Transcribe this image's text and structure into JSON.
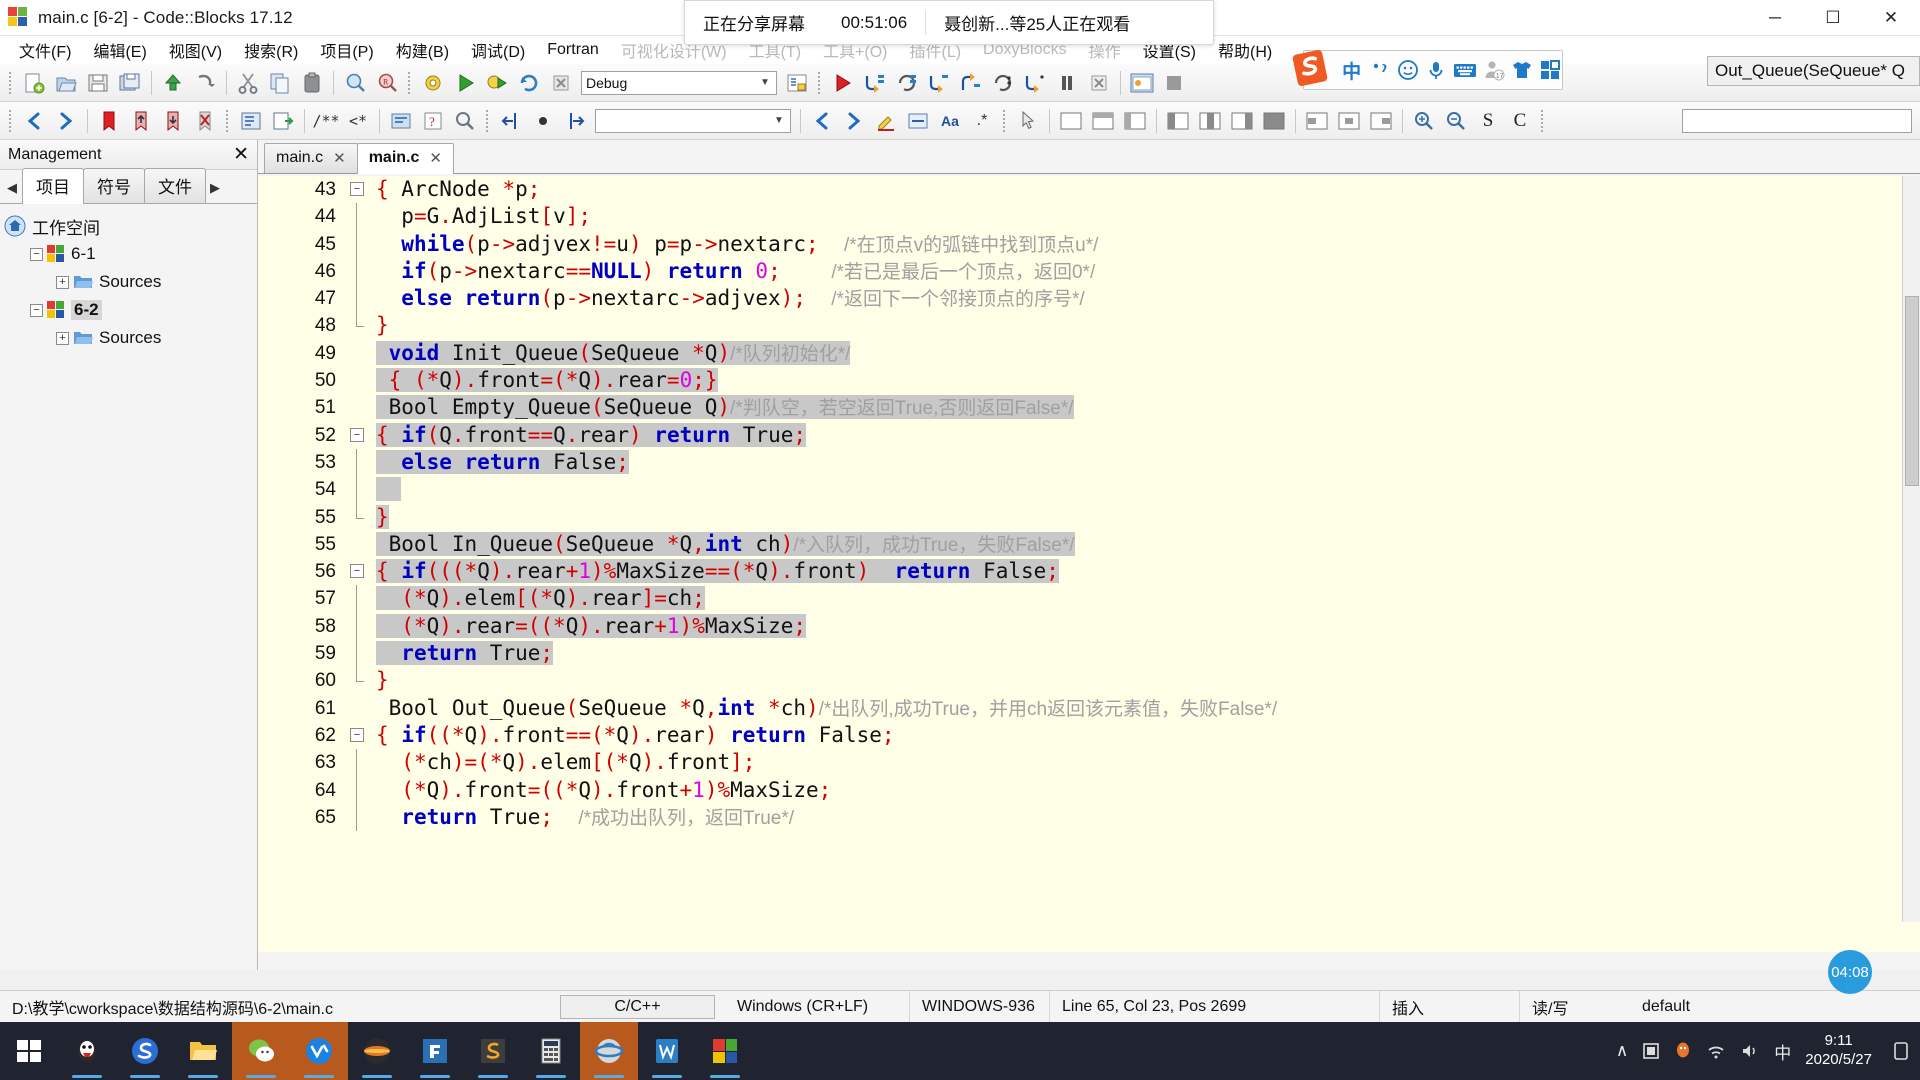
{
  "window": {
    "title": "main.c [6-2] - Code::Blocks 17.12",
    "minimize": "─",
    "maximize": "☐",
    "close": "✕"
  },
  "conference_overlay": {
    "sharing_label": "正在分享屏幕",
    "elapsed": "00:51:06",
    "viewers": "聂创新...等25人正在观看"
  },
  "menubar": {
    "items": [
      {
        "label": "文件(F)",
        "faded": false
      },
      {
        "label": "编辑(E)",
        "faded": false
      },
      {
        "label": "视图(V)",
        "faded": false
      },
      {
        "label": "搜索(R)",
        "faded": false
      },
      {
        "label": "项目(P)",
        "faded": false
      },
      {
        "label": "构建(B)",
        "faded": false
      },
      {
        "label": "调试(D)",
        "faded": false
      },
      {
        "label": "Fortran",
        "faded": false
      },
      {
        "label": "可视化设计(W)",
        "faded": true
      },
      {
        "label": "工具(T)",
        "faded": true
      },
      {
        "label": "工具+(O)",
        "faded": true
      },
      {
        "label": "插件(L)",
        "faded": true
      },
      {
        "label": "DoxyBlocks",
        "faded": true
      },
      {
        "label": "操作",
        "faded": true
      },
      {
        "label": "设置(S)",
        "faded": false
      },
      {
        "label": "帮助(H)",
        "faded": false
      }
    ]
  },
  "toolbar_main": {
    "build_target_value": "Debug",
    "build_target_arrow": "▼",
    "icons": [
      "new-file-icon",
      "open-file-icon",
      "save-icon",
      "save-all-icon",
      "undo-icon",
      "redo-icon",
      "cut-icon",
      "copy-icon",
      "paste-icon",
      "find-icon",
      "replace-icon",
      "build-icon",
      "run-icon",
      "build-and-run-icon",
      "rebuild-icon",
      "abort-icon",
      "build-target-select",
      "build-log-icon",
      "debug-continue-icon",
      "debug-next-line-icon",
      "debug-step-into-icon",
      "debug-step-out-icon",
      "debug-next-instruction-icon",
      "debug-step-into-instruction-icon",
      "debug-break-icon",
      "debug-stop-icon",
      "debugging-windows-icon",
      "various-info-icon"
    ]
  },
  "toolbar_secondary": {
    "scope_value": "",
    "scope_arrow": "▼",
    "search_value": "",
    "icons": [
      "back-icon",
      "forward-icon",
      "toggle-bookmark-icon",
      "prev-bookmark-icon",
      "next-bookmark-icon",
      "clear-bookmarks-icon",
      "fortran-workspace-icon",
      "fortran-jump-icon",
      "comment-icon",
      "uncomment-icon",
      "doxyblocks-extract-icon",
      "doxyblocks-config-icon",
      "scope-combo",
      "prev-function-icon",
      "next-function-icon",
      "highlight-icon",
      "format-icon",
      "case-icon",
      "wildcard-icon",
      "select-tool-icon",
      "frame-icon",
      "panel-icon",
      "note-icon",
      "layout-1-icon",
      "layout-2-icon",
      "layout-3-icon",
      "layout-4-icon",
      "box-1-icon",
      "box-2-icon",
      "box-3-icon",
      "box-4-icon",
      "zoom-in-icon",
      "zoom-out-icon",
      "spell-s-icon",
      "spell-c-icon"
    ]
  },
  "param_hint": "Out_Queue(SeQueue* Q",
  "sogou_toolbar": {
    "logo": "sogou-logo-icon",
    "items": [
      "chinese-mode-icon",
      "punctuation-icon",
      "emoji-icon",
      "voice-input-icon",
      "soft-keyboard-icon",
      "user-icon",
      "skin-icon",
      "toolbox-icon"
    ],
    "chinese_label": "中"
  },
  "management": {
    "title": "Management",
    "close_label": "✕",
    "prev_arrow": "◀",
    "next_arrow": "▶",
    "tabs": [
      {
        "label": "项目",
        "active": true
      },
      {
        "label": "符号",
        "active": false
      },
      {
        "label": "文件",
        "active": false
      }
    ],
    "tree": [
      {
        "label": "工作空间",
        "level": 0,
        "icon": "workspace-home-icon",
        "expander": null,
        "selected": false
      },
      {
        "label": "6-1",
        "level": 1,
        "icon": "project-icon",
        "expander": "−",
        "selected": false
      },
      {
        "label": "Sources",
        "level": 2,
        "icon": "folder-icon",
        "expander": "+",
        "selected": false
      },
      {
        "label": "6-2",
        "level": 1,
        "icon": "project-icon",
        "expander": "−",
        "selected": true
      },
      {
        "label": "Sources",
        "level": 2,
        "icon": "folder-icon",
        "expander": "+",
        "selected": false
      }
    ]
  },
  "editor": {
    "tabs": [
      {
        "label": "main.c",
        "active": false,
        "close": "✕"
      },
      {
        "label": "main.c",
        "active": true,
        "close": "✕"
      }
    ],
    "first_line": 43,
    "lines": [
      {
        "num": 43,
        "fold": "minus",
        "html": "<span class=\"p\">{</span> ArcNode <span class=\"p\">*</span>p<span class=\"p\">;</span>"
      },
      {
        "num": 44,
        "fold": "bar",
        "html": "  p<span class=\"p\">=</span>G<span class=\"p\">.</span>AdjList<span class=\"p\">[</span>v<span class=\"p\">];</span>"
      },
      {
        "num": 45,
        "fold": "bar",
        "html": "  <span class=\"k\">while</span><span class=\"p\">(</span>p<span class=\"p\">-&gt;</span>adjvex<span class=\"p\">!=</span>u<span class=\"p\">)</span> p<span class=\"p\">=</span>p<span class=\"p\">-&gt;</span>nextarc<span class=\"p\">;</span>  <span class=\"c\">/*在顶点v的弧链中找到顶点u*/</span>"
      },
      {
        "num": 46,
        "fold": "bar",
        "html": "  <span class=\"k\">if</span><span class=\"p\">(</span>p<span class=\"p\">-&gt;</span>nextarc<span class=\"p\">==</span><span class=\"k\">NULL</span><span class=\"p\">)</span> <span class=\"k\">return</span> <span class=\"n\">0</span><span class=\"p\">;</span>    <span class=\"c\">/*若已是最后一个顶点，返回0*/</span>"
      },
      {
        "num": 47,
        "fold": "bar",
        "html": "  <span class=\"k\">else</span> <span class=\"k\">return</span><span class=\"p\">(</span>p<span class=\"p\">-&gt;</span>nextarc<span class=\"p\">-&gt;</span>adjvex<span class=\"p\">);</span>  <span class=\"c\">/*返回下一个邻接顶点的序号*/</span>"
      },
      {
        "num": 48,
        "fold": "end",
        "html": "<span class=\"p\">}</span>"
      },
      {
        "num": 49,
        "fold": null,
        "html": "<span class=\"hl\"> <span class=\"k\">void</span> Init_Queue<span class=\"p\">(</span>SeQueue <span class=\"p\">*</span>Q<span class=\"p\">)</span><span class=\"c\">/*队列初始化*/</span></span>"
      },
      {
        "num": 50,
        "fold": null,
        "html": "<span class=\"hl\"> <span class=\"p\">{</span> <span class=\"p\">(*</span>Q<span class=\"p\">).</span>front<span class=\"p\">=(*</span>Q<span class=\"p\">).</span>rear<span class=\"p\">=</span><span class=\"n\">0</span><span class=\"p\">;}</span></span>"
      },
      {
        "num": 51,
        "fold": null,
        "html": "<span class=\"hl\"> Bool Empty_Queue<span class=\"p\">(</span>SeQueue Q<span class=\"p\">)</span><span class=\"c\">/*判队空，若空返回True,否则返回False*/</span></span>"
      },
      {
        "num": 52,
        "fold": "minus",
        "html": "<span class=\"hl\"><span class=\"p\">{</span> <span class=\"k\">if</span><span class=\"p\">(</span>Q<span class=\"p\">.</span>front<span class=\"p\">==</span>Q<span class=\"p\">.</span>rear<span class=\"p\">)</span> <span class=\"k\">return</span> True<span class=\"p\">;</span></span>"
      },
      {
        "num": 53,
        "fold": "bar",
        "html": "<span class=\"hl\">  <span class=\"k\">else</span> <span class=\"k\">return</span> False<span class=\"p\">;</span></span>"
      },
      {
        "num": 54,
        "fold": "bar",
        "html": "<span class=\"hl\">  </span>"
      },
      {
        "num": 55,
        "fold": "end",
        "html": "<span class=\"hl\"><span class=\"p\">}</span></span>"
      },
      {
        "num": 55,
        "fold": null,
        "html": "<span class=\"hl\"> Bool In_Queue<span class=\"p\">(</span>SeQueue <span class=\"p\">*</span>Q<span class=\"p\">,</span><span class=\"k\">int</span> ch<span class=\"p\">)</span><span class=\"c\">/*入队列，成功True，失败False*/</span></span>"
      },
      {
        "num": 56,
        "fold": "minus",
        "html": "<span class=\"hl\"><span class=\"p\">{</span> <span class=\"k\">if</span><span class=\"p\">(((*</span>Q<span class=\"p\">).</span>rear<span class=\"p\">+</span><span class=\"n\">1</span><span class=\"p\">)%</span>MaxSize<span class=\"p\">==(*</span>Q<span class=\"p\">).</span>front<span class=\"p\">)</span>  <span class=\"k\">return</span> False<span class=\"p\">;</span></span>"
      },
      {
        "num": 57,
        "fold": "bar",
        "html": "<span class=\"hl\">  <span class=\"p\">(*</span>Q<span class=\"p\">).</span>elem<span class=\"p\">[(*</span>Q<span class=\"p\">).</span>rear<span class=\"p\">]=</span>ch<span class=\"p\">;</span></span>"
      },
      {
        "num": 58,
        "fold": "bar",
        "html": "<span class=\"hl\">  <span class=\"p\">(*</span>Q<span class=\"p\">).</span>rear<span class=\"p\">=((*</span>Q<span class=\"p\">).</span>rear<span class=\"p\">+</span><span class=\"n\">1</span><span class=\"p\">)%</span>MaxSize<span class=\"p\">;</span></span>"
      },
      {
        "num": 59,
        "fold": "bar",
        "html": "<span class=\"hl\">  <span class=\"k\">return</span> True<span class=\"p\">;</span></span>"
      },
      {
        "num": 60,
        "fold": "end",
        "html": "<span class=\"p\">}</span>"
      },
      {
        "num": 61,
        "fold": null,
        "html": " Bool Out_Queue<span class=\"p\">(</span>SeQueue <span class=\"p\">*</span>Q<span class=\"p\">,</span><span class=\"k\">int</span> <span class=\"p\">*</span>ch<span class=\"p\">)</span><span class=\"c\">/*出队列,成功True，并用ch返回该元素值，失败False*/</span>"
      },
      {
        "num": 62,
        "fold": "minus",
        "html": "<span class=\"p\">{</span> <span class=\"k\">if</span><span class=\"p\">((*</span>Q<span class=\"p\">).</span>front<span class=\"p\">==(*</span>Q<span class=\"p\">).</span>rear<span class=\"p\">)</span> <span class=\"k\">return</span> False<span class=\"p\">;</span>"
      },
      {
        "num": 63,
        "fold": "bar",
        "html": "  <span class=\"p\">(*</span>ch<span class=\"p\">)=(*</span>Q<span class=\"p\">).</span>elem<span class=\"p\">[(*</span>Q<span class=\"p\">).</span>front<span class=\"p\">];</span>"
      },
      {
        "num": 64,
        "fold": "bar",
        "html": "  <span class=\"p\">(*</span>Q<span class=\"p\">).</span>front<span class=\"p\">=((*</span>Q<span class=\"p\">).</span>front<span class=\"p\">+</span><span class=\"n\">1</span><span class=\"p\">)%</span>MaxSize<span class=\"p\">;</span>"
      },
      {
        "num": 65,
        "fold": "bar",
        "html": "  <span class=\"k\">return</span> True<span class=\"p\">;</span>  <span class=\"c\">/*成功出队列，返回True*/</span>"
      }
    ]
  },
  "timer_badge": "04:08",
  "statusbar": {
    "path": "D:\\教学\\cworkspace\\数据结构源码\\6-2\\main.c",
    "language": "C/C++",
    "line_ending": "Windows (CR+LF)",
    "encoding": "WINDOWS-936",
    "caret": "Line 65, Col 23, Pos 2699",
    "insert_mode": "插入",
    "read_write": "读/写",
    "profile": "default"
  },
  "taskbar": {
    "start": "start-button",
    "items": [
      {
        "name": "taskbar-qq",
        "running": true,
        "active": false
      },
      {
        "name": "taskbar-sogou-browser",
        "running": true,
        "active": false
      },
      {
        "name": "taskbar-file-explorer",
        "running": true,
        "active": false
      },
      {
        "name": "taskbar-wechat",
        "running": true,
        "active": true
      },
      {
        "name": "taskbar-tencent-meeting",
        "running": true,
        "active": true
      },
      {
        "name": "taskbar-firefox",
        "running": true,
        "active": false
      },
      {
        "name": "taskbar-editor",
        "running": true,
        "active": false
      },
      {
        "name": "taskbar-sublime",
        "running": true,
        "active": false
      },
      {
        "name": "taskbar-calculator",
        "running": true,
        "active": false
      },
      {
        "name": "taskbar-ie",
        "running": true,
        "active": true
      },
      {
        "name": "taskbar-wps",
        "running": true,
        "active": false
      },
      {
        "name": "taskbar-codeblocks",
        "running": true,
        "active": false
      }
    ],
    "tray": {
      "chevron": "∧",
      "icons": [
        "tray-show-desktop-icon",
        "tray-qq-icon",
        "tray-network-icon",
        "tray-volume-icon",
        "tray-ime-icon"
      ],
      "ime_label": "中",
      "time": "9:11",
      "date": "2020/5/27",
      "action_center": "notification-icon"
    }
  }
}
